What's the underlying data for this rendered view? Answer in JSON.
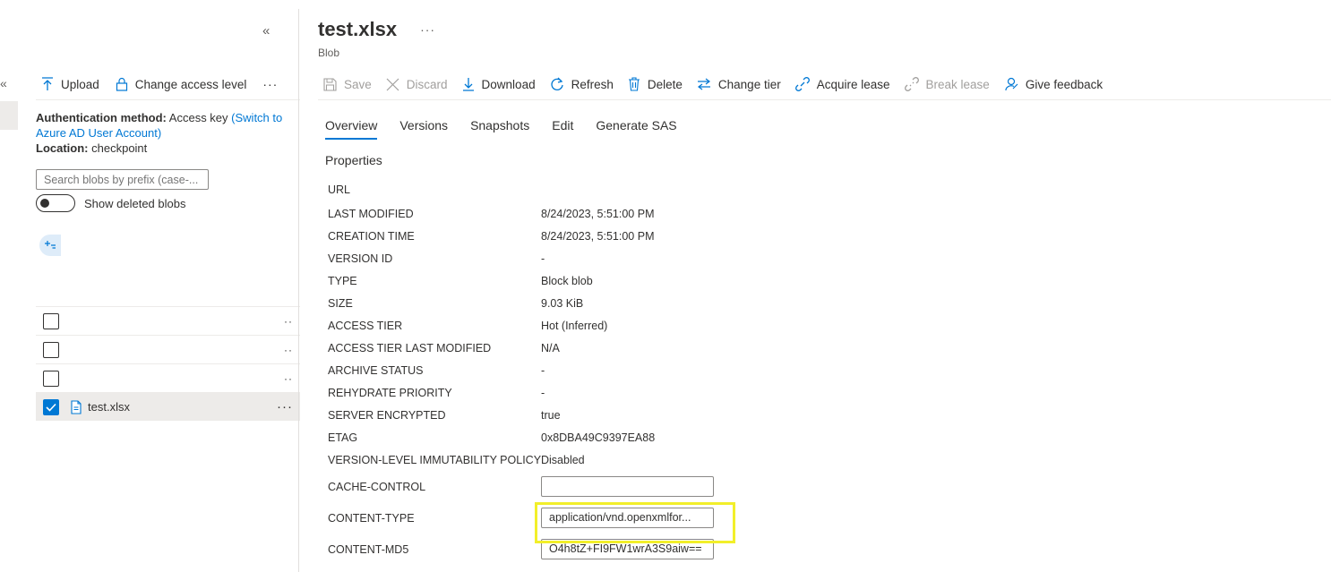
{
  "left": {
    "collapse_glyph": "«",
    "toolbar": {
      "upload": "Upload",
      "change_access": "Change access level",
      "more": "···"
    },
    "auth": {
      "method_label": "Authentication method:",
      "method_value": "Access key",
      "switch_link": "(Switch to Azure AD User Account)",
      "location_label": "Location:",
      "location_value": "checkpoint"
    },
    "search": {
      "placeholder": "Search blobs by prefix (case-..."
    },
    "show_deleted": "Show deleted blobs",
    "blobs": [
      {
        "name": "",
        "more": "··"
      },
      {
        "name": "",
        "more": "··"
      },
      {
        "name": "",
        "more": "··"
      },
      {
        "name": "test.xlsx",
        "more": "···"
      }
    ]
  },
  "detail": {
    "title": "test.xlsx",
    "title_more": "···",
    "subtitle": "Blob",
    "commands": {
      "save": "Save",
      "discard": "Discard",
      "download": "Download",
      "refresh": "Refresh",
      "delete": "Delete",
      "change_tier": "Change tier",
      "acquire_lease": "Acquire lease",
      "break_lease": "Break lease",
      "give_feedback": "Give feedback"
    },
    "tabs": [
      "Overview",
      "Versions",
      "Snapshots",
      "Edit",
      "Generate SAS"
    ],
    "properties_heading": "Properties",
    "properties": [
      {
        "key": "URL",
        "value": ""
      },
      {
        "key": "LAST MODIFIED",
        "value": "8/24/2023, 5:51:00 PM"
      },
      {
        "key": "CREATION TIME",
        "value": "8/24/2023, 5:51:00 PM"
      },
      {
        "key": "VERSION ID",
        "value": "-"
      },
      {
        "key": "TYPE",
        "value": "Block blob"
      },
      {
        "key": "SIZE",
        "value": "9.03 KiB"
      },
      {
        "key": "ACCESS TIER",
        "value": "Hot (Inferred)"
      },
      {
        "key": "ACCESS TIER LAST MODIFIED",
        "value": "N/A"
      },
      {
        "key": "ARCHIVE STATUS",
        "value": "-"
      },
      {
        "key": "REHYDRATE PRIORITY",
        "value": "-"
      },
      {
        "key": "SERVER ENCRYPTED",
        "value": "true"
      },
      {
        "key": "ETAG",
        "value": "0x8DBA49C9397EA88"
      },
      {
        "key": "VERSION-LEVEL IMMUTABILITY POLICY",
        "value": "Disabled"
      }
    ],
    "editable": {
      "cache_control_label": "CACHE-CONTROL",
      "cache_control_value": "",
      "content_type_label": "CONTENT-TYPE",
      "content_type_value": "application/vnd.openxmlfor...",
      "content_md5_label": "CONTENT-MD5",
      "content_md5_value": "O4h8tZ+FI9FW1wrA3S9aiw=="
    },
    "colors": {
      "accent": "#0078d4",
      "highlight": "#f2ef2a"
    }
  }
}
